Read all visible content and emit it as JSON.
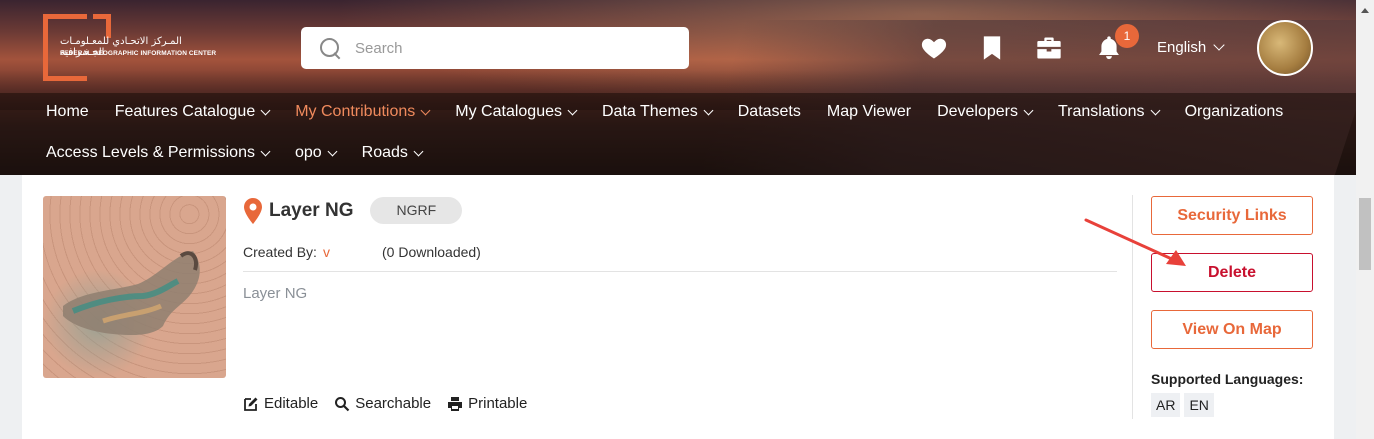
{
  "header": {
    "logo_ar": "المـركز الاتحـادي للمعـلومـات الجـغـرافية",
    "logo_en": "FEDERAL GEOGRAPHIC INFORMATION CENTER",
    "search_placeholder": "Search",
    "notification_count": "1",
    "language": "English",
    "icons": [
      "heart-icon",
      "bookmark-icon",
      "briefcase-icon",
      "bell-icon"
    ]
  },
  "nav": {
    "row1": [
      {
        "label": "Home"
      },
      {
        "label": "Features Catalogue"
      },
      {
        "label": "My Contributions"
      },
      {
        "label": "My Catalogues"
      },
      {
        "label": "Data Themes"
      },
      {
        "label": "Datasets"
      },
      {
        "label": "Map Viewer"
      },
      {
        "label": "Developers"
      },
      {
        "label": "Translations"
      },
      {
        "label": "Organizations"
      }
    ],
    "row2": [
      {
        "label": "Access Levels & Permissions"
      },
      {
        "label": "opo"
      },
      {
        "label": "Roads"
      }
    ]
  },
  "item": {
    "title": "Layer NG",
    "tag": "NGRF",
    "created_by_label": "Created By:",
    "created_by_value": "v",
    "downloaded": "(0 Downloaded)",
    "description": "Layer NG",
    "features": [
      "Editable",
      "Searchable",
      "Printable"
    ]
  },
  "actions": {
    "security_links": "Security Links",
    "delete": "Delete",
    "view_on_map": "View On Map",
    "supported_languages_label": "Supported Languages:",
    "languages": [
      "AR",
      "EN"
    ]
  },
  "colors": {
    "accent": "#e8683a",
    "delete": "#c8102e",
    "annotation_arrow": "#e8413a"
  }
}
